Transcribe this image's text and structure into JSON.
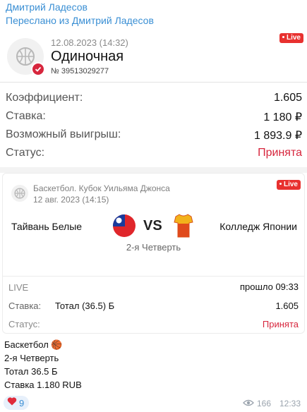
{
  "message": {
    "sender": "Дмитрий Ладесов",
    "forwarded_from": "Переслано из Дмитрий Ладесов"
  },
  "bet": {
    "date": "12.08.2023 (14:32)",
    "type": "Одиночная",
    "number": "№ 39513029277",
    "live_label": "Live",
    "rows": [
      {
        "label": "Коэффициент:",
        "value": "1.605"
      },
      {
        "label": "Ставка:",
        "value": "1 180 ₽"
      },
      {
        "label": "Возможный выигрыш:",
        "value": "1 893.9 ₽"
      },
      {
        "label": "Статус:",
        "value": "Принята"
      }
    ]
  },
  "event": {
    "tournament": "Баскетбол. Кубок Уильяма Джонса",
    "date": "12 авг. 2023 (14:15)",
    "live_label": "Live",
    "home_team": "Тайвань Белые",
    "vs": "VS",
    "away_team": "Колледж Японии",
    "period": "2-я Четверть",
    "live_state": "LIVE",
    "elapsed": "прошло 09:33",
    "stake_label": "Ставка:",
    "market": "Тотал (36.5) Б",
    "odds": "1.605",
    "status_label": "Статус:",
    "status_value": "Принята"
  },
  "caption": {
    "line1": "Баскетбол 🏀",
    "line2": "2-я Четверть",
    "line3": "Тотал 36.5 Б",
    "line4": "Ставка 1.180 RUB"
  },
  "footer": {
    "reaction_count": "9",
    "views": "166",
    "time": "12:33"
  },
  "colors": {
    "accent": "#3a8fd4",
    "status_red": "#d7263d",
    "live_red": "#e8312f"
  },
  "icons": [
    "basketball-icon",
    "check-icon",
    "heart-icon",
    "eye-icon",
    "flag-taiwan-icon",
    "jersey-icon"
  ]
}
